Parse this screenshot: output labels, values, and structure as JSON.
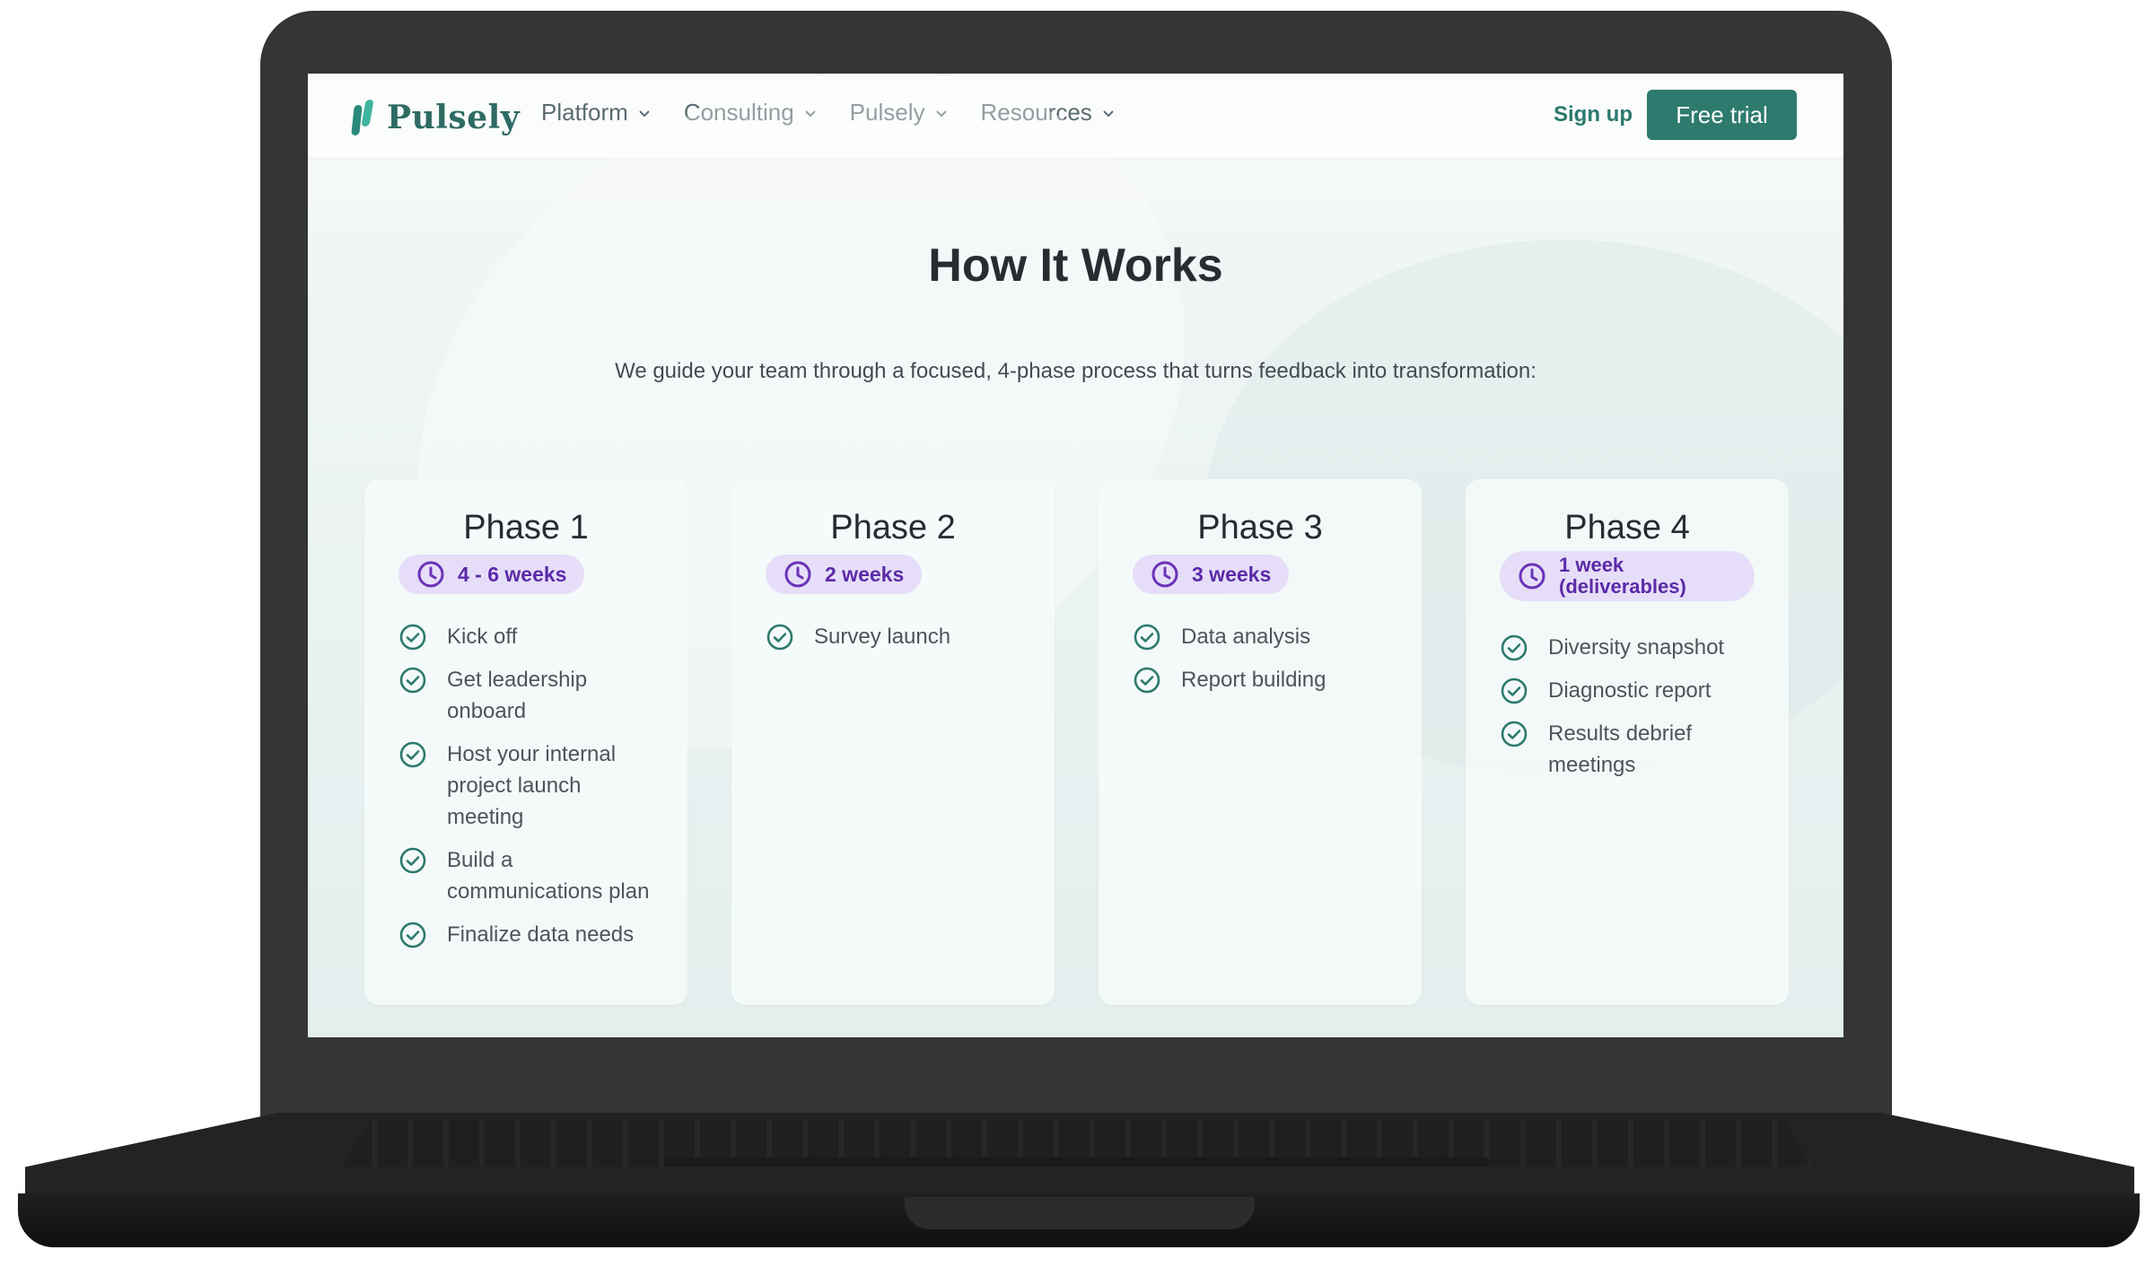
{
  "nav": {
    "logo": "Pulsely",
    "menu": [
      "Platform",
      "Consulting",
      "Pulsely",
      "Resources"
    ],
    "signup": "Sign up",
    "trial": "Free trial"
  },
  "hero": {
    "title": "How It Works",
    "subtitle": "We guide your team through a focused, 4-phase process that turns feedback into transformation:"
  },
  "phases": [
    {
      "title": "Phase 1",
      "duration": "4 - 6 weeks",
      "items": [
        "Kick off",
        "Get leadership onboard",
        "Host your internal project launch meeting",
        "Build a communications plan",
        "Finalize data needs"
      ]
    },
    {
      "title": "Phase 2",
      "duration": "2 weeks",
      "items": [
        "Survey launch"
      ]
    },
    {
      "title": "Phase 3",
      "duration": "3 weeks",
      "items": [
        "Data analysis",
        "Report building"
      ]
    },
    {
      "title": "Phase 4",
      "duration": "1 week (deliverables)",
      "items": [
        "Diversity snapshot",
        "Diagnostic report",
        "Results debrief meetings"
      ]
    }
  ],
  "icons": {
    "clock": "clock-icon",
    "check": "check-circle-icon",
    "chevron": "chevron-down-icon"
  },
  "colors": {
    "brand": "#2e7a6e",
    "badge_bg": "#e6def8",
    "badge_text": "#5b2aa8"
  }
}
